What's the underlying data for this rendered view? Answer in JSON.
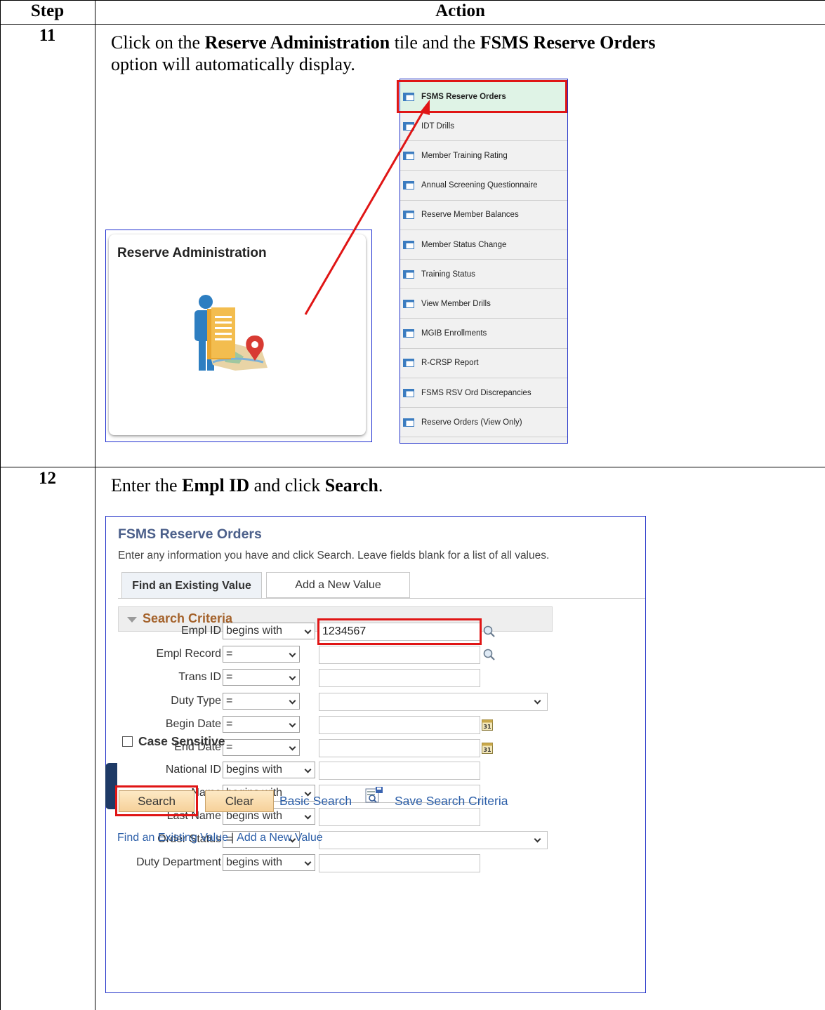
{
  "table": {
    "header_step": "Step",
    "header_action": "Action",
    "steps": [
      {
        "number": "11",
        "instruction_parts": [
          "Click on the ",
          "Reserve Administration",
          " tile and the ",
          "FSMS Reserve Orders",
          " option will automatically display."
        ]
      },
      {
        "number": "12",
        "instruction_parts": [
          "Enter the ",
          "Empl ID",
          " and click ",
          "Search",
          "."
        ]
      }
    ]
  },
  "tile": {
    "title": "Reserve Administration",
    "icon": "reserve-admin-icon"
  },
  "menu": {
    "items": [
      "FSMS Reserve Orders",
      "IDT Drills",
      "Member Training Rating",
      "Annual Screening Questionnaire",
      "Reserve Member Balances",
      "Member Status Change",
      "Training Status",
      "View Member Drills",
      "MGIB Enrollments",
      "R-CRSP Report",
      "FSMS RSV Ord Discrepancies",
      "Reserve Orders (View Only)"
    ],
    "selected_index": 0
  },
  "search_page": {
    "title": "FSMS Reserve Orders",
    "instructions": "Enter any information you have and click Search. Leave fields blank for a list of all values.",
    "tabs": [
      "Find an Existing Value",
      "Add a New Value"
    ],
    "criteria_header": "Search Criteria",
    "fields": [
      {
        "label": "Empl ID",
        "operator": "begins with",
        "value": "1234567"
      },
      {
        "label": "Empl Record",
        "operator": "=",
        "value": ""
      },
      {
        "label": "Trans ID",
        "operator": "=",
        "value": ""
      },
      {
        "label": "Duty Type",
        "operator": "=",
        "value": ""
      },
      {
        "label": "Begin Date",
        "operator": "=",
        "value": ""
      },
      {
        "label": "End Date",
        "operator": "=",
        "value": ""
      },
      {
        "label": "National ID",
        "operator": "begins with",
        "value": ""
      },
      {
        "label": "Name",
        "operator": "begins with",
        "value": ""
      },
      {
        "label": "Last Name",
        "operator": "begins with",
        "value": ""
      },
      {
        "label": "Order Status",
        "operator": "=",
        "value": ""
      },
      {
        "label": "Duty Department",
        "operator": "begins with",
        "value": ""
      }
    ],
    "case_sensitive_label": "Case Sensitive",
    "buttons": {
      "search": "Search",
      "clear": "Clear",
      "basic_search": "Basic Search",
      "save_criteria": "Save Search Criteria"
    },
    "bottom_links": [
      "Find an Existing Value",
      "Add a New Value"
    ],
    "colors": {
      "title": "#4b5f8a",
      "criteria_header": "#a4622b",
      "link": "#2b5ea8",
      "highlight_box": "#e01515"
    }
  }
}
